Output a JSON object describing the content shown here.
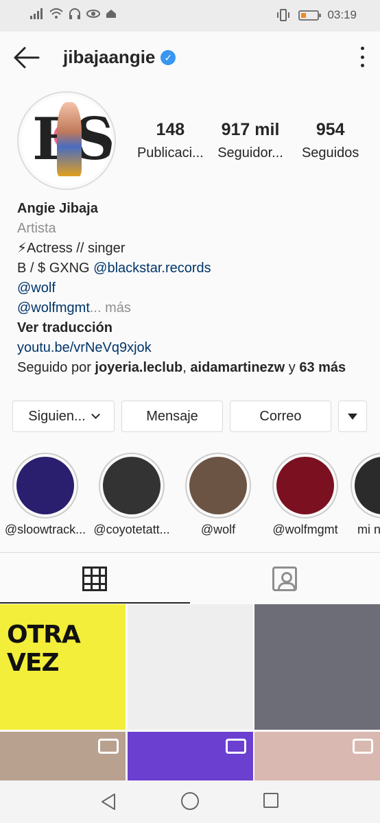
{
  "status_bar": {
    "time": "03:19"
  },
  "header": {
    "username": "jibajaangie",
    "verified_icon": "check-badge"
  },
  "profile": {
    "stats": [
      {
        "num": "148",
        "label": "Publicaci..."
      },
      {
        "num": "917 mil",
        "label": "Seguidor..."
      },
      {
        "num": "954",
        "label": "Seguidos"
      }
    ],
    "name": "Angie Jibaja",
    "category": "Artista",
    "bio_line1": "⚡Actress // singer",
    "bio_line2_prefix": "B / $ GXNG ",
    "bio_line2_link": "@blackstar.records",
    "bio_line3": "@wolf",
    "bio_line4_link": "@wolfmgmt",
    "bio_line4_more": "... más",
    "translate": "Ver traducción",
    "website": "youtu.be/vrNeVq9xjok",
    "followed_prefix": "Seguido por ",
    "followed_user1": "joyeria.leclub",
    "followed_sep": ", ",
    "followed_user2": "aidamartinezw",
    "followed_and": " y ",
    "followed_more": "63 más"
  },
  "buttons": {
    "following": "Siguien...",
    "message": "Mensaje",
    "email": "Correo"
  },
  "highlights": [
    {
      "label": "@sloowtrack...",
      "color": "#2a1e6e"
    },
    {
      "label": "@coyotetatt...",
      "color": "#333333"
    },
    {
      "label": "@wolf",
      "color": "#6b5444"
    },
    {
      "label": "@wolfmgmt",
      "color": "#7a1020"
    },
    {
      "label": "mi n",
      "color": "#2b2b2b"
    }
  ],
  "posts": [
    {
      "title": "OTRA VEZ",
      "color": "#f2ee3a",
      "video": false
    },
    {
      "title": "",
      "color": "#eeeeee",
      "video": false
    },
    {
      "title": "",
      "color": "#6d6d78",
      "video": false
    },
    {
      "title": "",
      "color": "#b9a190",
      "video": true
    },
    {
      "title": "",
      "color": "#6b3fd0",
      "video": true
    },
    {
      "title": "",
      "color": "#d8b8b0",
      "video": true
    }
  ]
}
